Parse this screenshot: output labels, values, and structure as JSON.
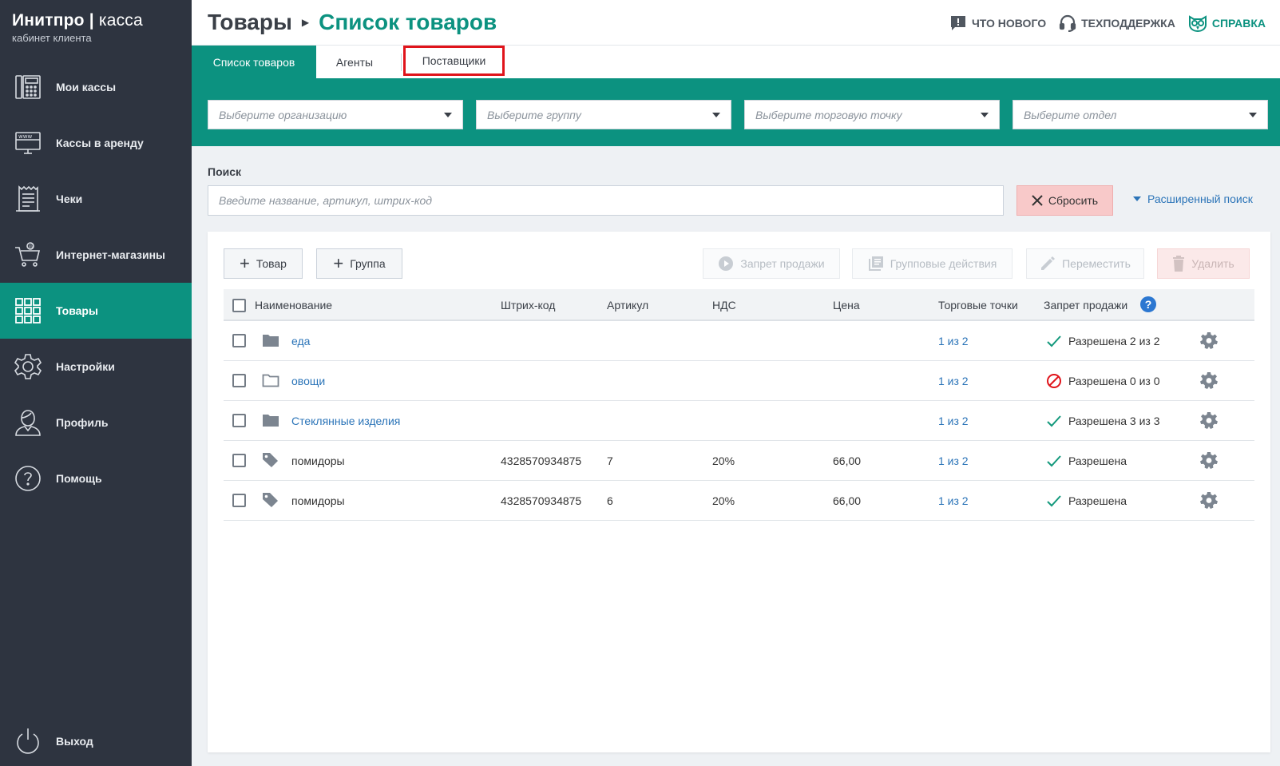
{
  "brand": {
    "name": "Инитпро",
    "product": "касса",
    "subtitle": "кабинет клиента"
  },
  "sidebar": {
    "items": [
      {
        "label": "Мои кассы",
        "icon": "cash-register-icon"
      },
      {
        "label": "Кассы в аренду",
        "icon": "www-monitor-icon"
      },
      {
        "label": "Чеки",
        "icon": "receipt-icon"
      },
      {
        "label": "Интернет-магазины",
        "icon": "shopping-cart-icon"
      },
      {
        "label": "Товары",
        "icon": "grid-icon",
        "active": true
      },
      {
        "label": "Настройки",
        "icon": "gear-icon"
      },
      {
        "label": "Профиль",
        "icon": "user-icon"
      },
      {
        "label": "Помощь",
        "icon": "question-icon"
      }
    ],
    "logout": "Выход"
  },
  "header": {
    "breadcrumb_root": "Товары",
    "breadcrumb_current": "Список товаров",
    "links": {
      "news": "Что нового",
      "support": "Техподдержка",
      "help": "Справка"
    }
  },
  "tabs": {
    "products": "Список товаров",
    "agents": "Агенты",
    "suppliers": "Поставщики"
  },
  "filters": {
    "organization": "Выберите организацию",
    "group": "Выберите группу",
    "store": "Выберите торговую точку",
    "department": "Выберите отдел"
  },
  "search": {
    "label": "Поиск",
    "placeholder": "Введите название, артикул, штрих-код",
    "reset": "Сбросить",
    "advanced": "Расширенный поиск"
  },
  "toolbar": {
    "add_product": "Товар",
    "add_group": "Группа",
    "ban_sale": "Запрет продажи",
    "group_actions": "Групповые действия",
    "move": "Переместить",
    "delete": "Удалить"
  },
  "table": {
    "columns": {
      "name": "Наименование",
      "barcode": "Штрих-код",
      "article": "Артикул",
      "vat": "НДС",
      "price": "Цена",
      "stores": "Торговые точки",
      "ban": "Запрет продажи"
    },
    "rows": [
      {
        "type": "folder",
        "name": "еда",
        "barcode": "",
        "article": "",
        "vat": "",
        "price": "",
        "stores": "1 из 2",
        "status": "Разрешена 2 из 2",
        "status_ok": true
      },
      {
        "type": "folder-empty",
        "name": "овощи",
        "barcode": "",
        "article": "",
        "vat": "",
        "price": "",
        "stores": "1 из 2",
        "status": "Разрешена 0 из 0",
        "status_ok": false
      },
      {
        "type": "folder",
        "name": "Стеклянные изделия",
        "barcode": "",
        "article": "",
        "vat": "",
        "price": "",
        "stores": "1 из 2",
        "status": "Разрешена 3 из 3",
        "status_ok": true
      },
      {
        "type": "item",
        "name": "помидоры",
        "barcode": "4328570934875",
        "article": "7",
        "vat": "20%",
        "price": "66,00",
        "stores": "1 из 2",
        "status": "Разрешена",
        "status_ok": true
      },
      {
        "type": "item",
        "name": "помидоры",
        "barcode": "4328570934875",
        "article": "6",
        "vat": "20%",
        "price": "66,00",
        "stores": "1 из 2",
        "status": "Разрешена",
        "status_ok": true
      }
    ]
  },
  "colors": {
    "accent": "#0c9280",
    "sidebar": "#2e3440",
    "link": "#2b74b8",
    "highlight": "#e0141b"
  }
}
